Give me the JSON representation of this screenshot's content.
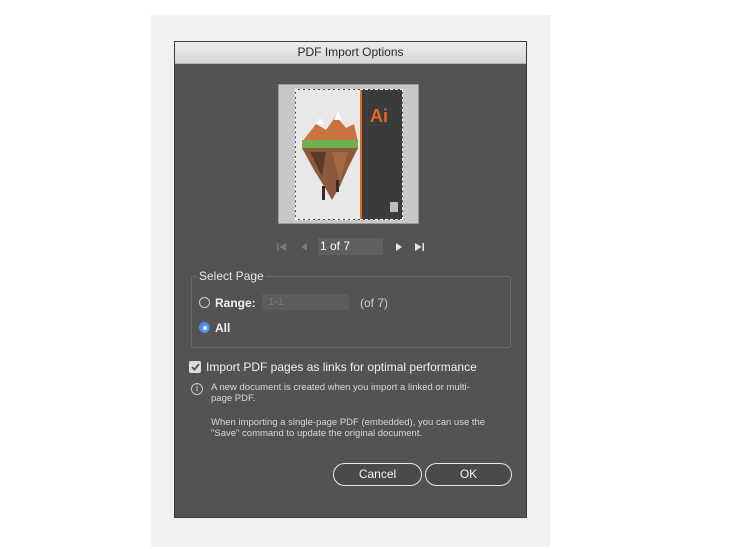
{
  "dialog": {
    "title": "PDF Import Options"
  },
  "preview": {
    "logo_text": "Ai"
  },
  "navigation": {
    "page_indicator": "1 of 7"
  },
  "select_page": {
    "legend": "Select Page",
    "range_label": "Range:",
    "range_placeholder": "1-1",
    "range_of": "(of 7)",
    "all_label": "All",
    "selected": "All"
  },
  "import_links": {
    "label": "Import PDF pages as links for optimal performance",
    "checked": true
  },
  "info": {
    "line1": "A new document is created when you import a linked or multi-",
    "line2": "page PDF.",
    "line3": "When importing a single-page PDF (embedded), you can use the",
    "line4": "\"Save\" command to update the original document."
  },
  "buttons": {
    "cancel": "Cancel",
    "ok": "OK"
  },
  "colors": {
    "dialog_bg": "#535353",
    "accent_orange": "#e46a1c",
    "radio_selected": "#4d8ff0"
  }
}
